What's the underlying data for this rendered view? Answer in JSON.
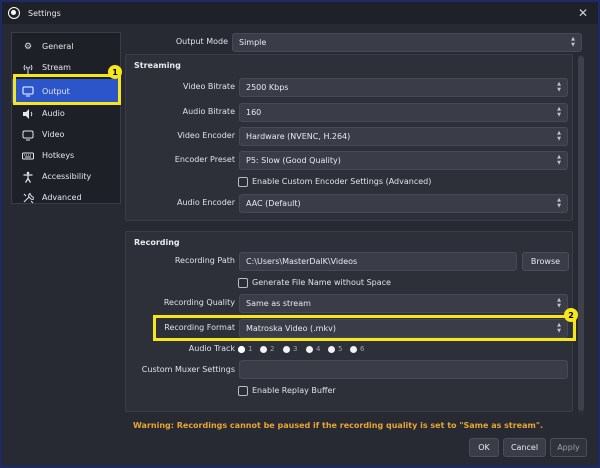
{
  "window": {
    "title": "Settings",
    "close_glyph": "✕"
  },
  "sidebar": {
    "items": [
      {
        "label": "General",
        "icon": "gear-icon"
      },
      {
        "label": "Stream",
        "icon": "antenna-icon"
      },
      {
        "label": "Output",
        "icon": "output-icon"
      },
      {
        "label": "Audio",
        "icon": "speaker-icon"
      },
      {
        "label": "Video",
        "icon": "monitor-icon"
      },
      {
        "label": "Hotkeys",
        "icon": "keyboard-icon"
      },
      {
        "label": "Accessibility",
        "icon": "accessibility-icon"
      },
      {
        "label": "Advanced",
        "icon": "wrench-icon"
      }
    ],
    "active": "Output"
  },
  "callouts": {
    "one": "1",
    "two": "2"
  },
  "output_mode": {
    "label": "Output Mode",
    "value": "Simple"
  },
  "streaming": {
    "title": "Streaming",
    "video_bitrate": {
      "label": "Video Bitrate",
      "value": "2500 Kbps"
    },
    "audio_bitrate": {
      "label": "Audio Bitrate",
      "value": "160"
    },
    "video_encoder": {
      "label": "Video Encoder",
      "value": "Hardware (NVENC, H.264)"
    },
    "encoder_preset": {
      "label": "Encoder Preset",
      "value": "P5: Slow (Good Quality)"
    },
    "custom_encoder_label": "Enable Custom Encoder Settings (Advanced)",
    "audio_encoder": {
      "label": "Audio Encoder",
      "value": "AAC (Default)"
    }
  },
  "recording": {
    "title": "Recording",
    "path": {
      "label": "Recording Path",
      "value": "C:\\Users\\MasterDalK\\Videos"
    },
    "browse_label": "Browse",
    "filename_no_space_label": "Generate File Name without Space",
    "quality": {
      "label": "Recording Quality",
      "value": "Same as stream"
    },
    "format": {
      "label": "Recording Format",
      "value": "Matroska Video (.mkv)"
    },
    "audio_track": {
      "label": "Audio Track",
      "tracks": [
        "1",
        "2",
        "3",
        "4",
        "5",
        "6"
      ]
    },
    "custom_muxer": {
      "label": "Custom Muxer Settings",
      "value": ""
    },
    "replay_buffer_label": "Enable Replay Buffer"
  },
  "warning": "Warning: Recordings cannot be paused if the recording quality is set to \"Same as stream\".",
  "buttons": {
    "ok": "OK",
    "cancel": "Cancel",
    "apply": "Apply"
  },
  "colors": {
    "highlight": "#f5e71a",
    "active": "#2b55c8",
    "warning": "#e8a530"
  }
}
